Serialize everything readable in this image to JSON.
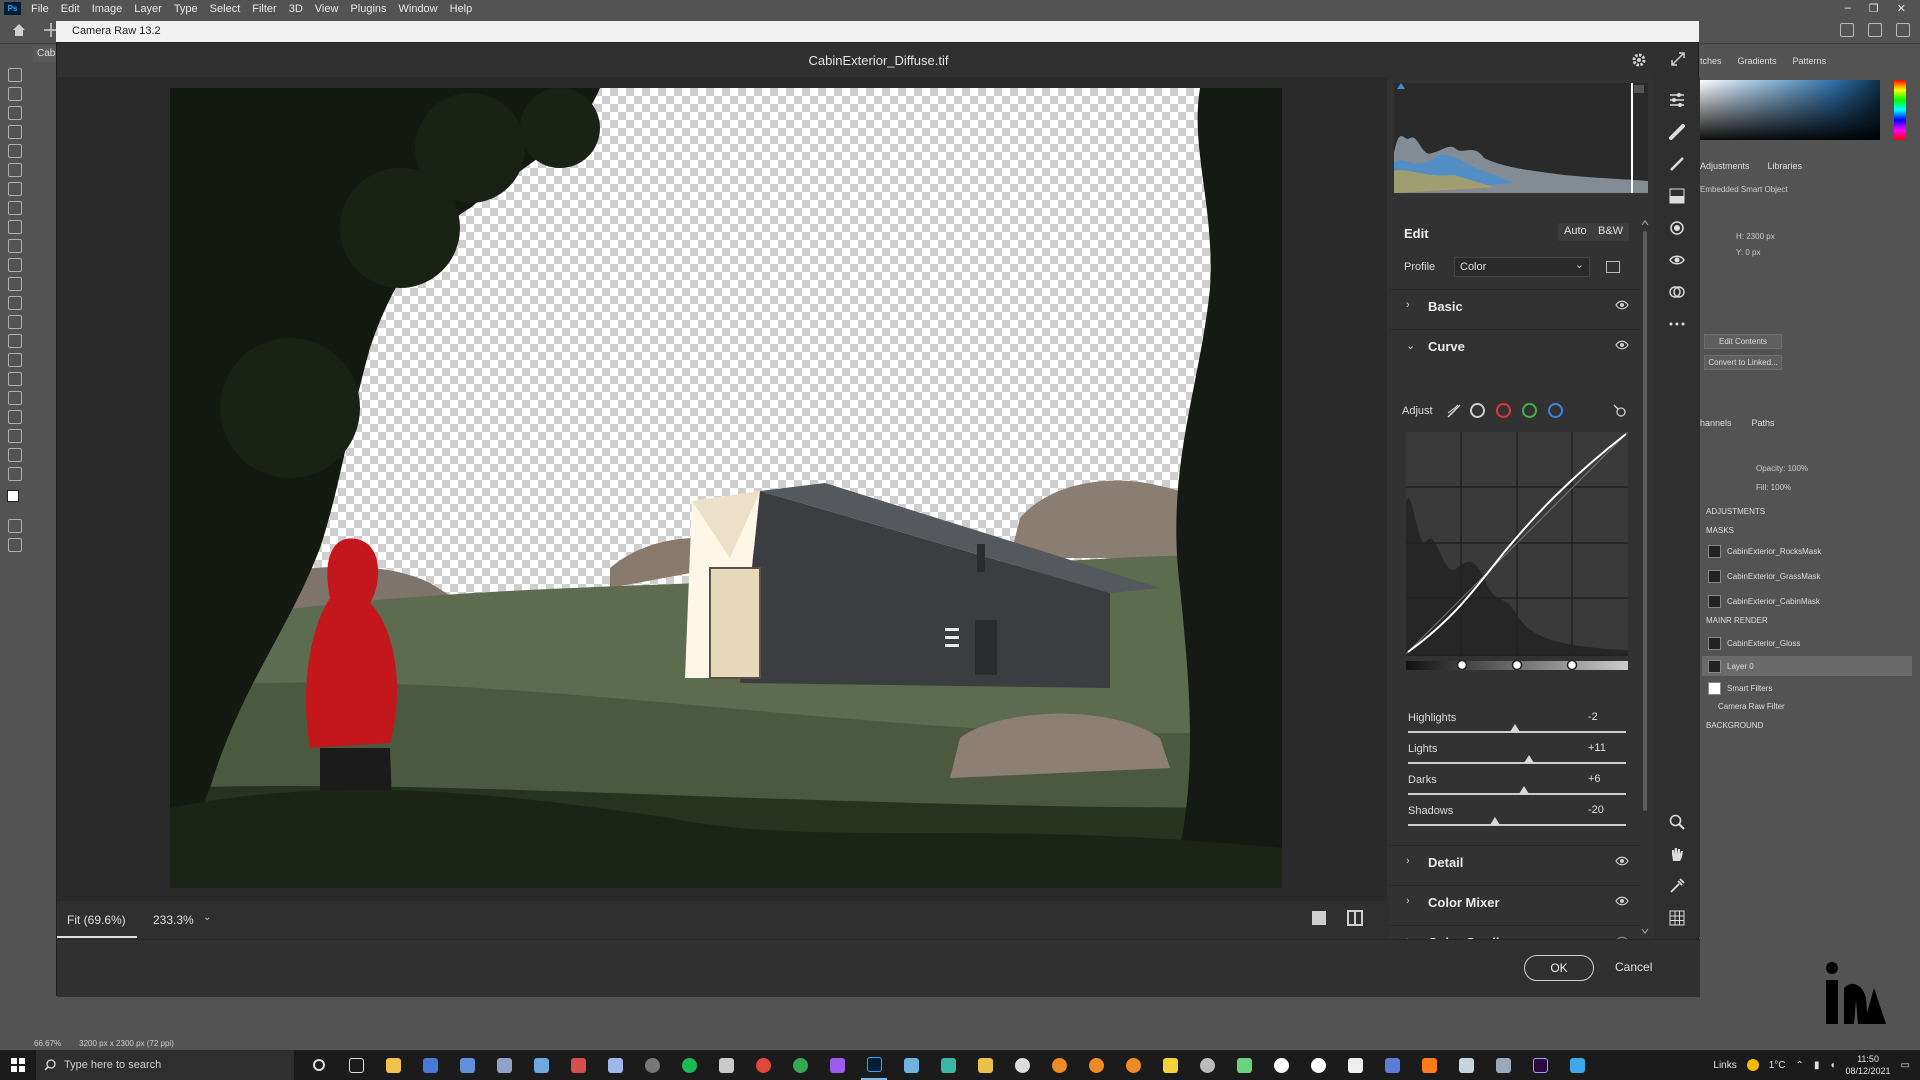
{
  "menubar": {
    "logo": "Ps",
    "items": [
      "File",
      "Edit",
      "Image",
      "Layer",
      "Type",
      "Select",
      "Filter",
      "3D",
      "View",
      "Plugins",
      "Window",
      "Help"
    ],
    "controls": [
      "–",
      "❐",
      "✕"
    ]
  },
  "camera_raw": {
    "window_title": "Camera Raw 13.2",
    "file_name": "CabinExterior_Diffuse.tif",
    "zoom_fit": "Fit (69.6%)",
    "zoom_level": "233.3%",
    "edit": {
      "title": "Edit",
      "auto_label": "Auto",
      "bw_label": "B&W",
      "profile_label": "Profile",
      "profile_value": "Color"
    },
    "sections": {
      "basic": "Basic",
      "curve": "Curve",
      "detail": "Detail",
      "color_mixer": "Color Mixer",
      "color_grading": "Color Grading"
    },
    "curve": {
      "adjust_label": "Adjust",
      "highlights": {
        "label": "Highlights",
        "value": "-2",
        "position": 0.49
      },
      "lights": {
        "label": "Lights",
        "value": "+11",
        "position": 0.555
      },
      "darks": {
        "label": "Darks",
        "value": "+6",
        "position": 0.53
      },
      "shadows": {
        "label": "Shadows",
        "value": "-20",
        "position": 0.4
      }
    },
    "ok_label": "OK",
    "cancel_label": "Cancel"
  },
  "ps": {
    "doc_tab": "CabinE",
    "right_tabs": [
      "tches",
      "Gradients",
      "Patterns"
    ],
    "panel_tabs": [
      "Adjustments",
      "Libraries"
    ],
    "smart_object": "Embedded Smart Object",
    "h_field": "H: 2300 px",
    "y_field": "Y: 0 px",
    "edit_contents": "Edit Contents",
    "convert_linked": "Convert to Linked...",
    "layer_tabs": [
      "hannels",
      "Paths"
    ],
    "opacity": "Opacity: 100%",
    "fill": "Fill: 100%",
    "layers": {
      "adjustments": "ADJUSTMENTS",
      "masks": "MASKS",
      "rocks": "CabinExterior_RocksMask",
      "grass": "CabinExterior_GrassMask",
      "cabin": "CabinExterior_CabinMask",
      "main_render": "MAINR RENDER",
      "gloss": "CabinExterior_Gloss",
      "layer0": "Layer 0",
      "smart_filters": "Smart Filters",
      "camera_raw_filter": "Camera Raw Filter",
      "background": "BACKGROUND"
    },
    "status_zoom": "66.67%",
    "status_size": "3200 px x 2300 px (72 ppi)"
  },
  "taskbar": {
    "search_placeholder": "Type here to search",
    "links": "Links",
    "temperature": "1°C",
    "time": "11:50",
    "date": "08/12/2021"
  }
}
